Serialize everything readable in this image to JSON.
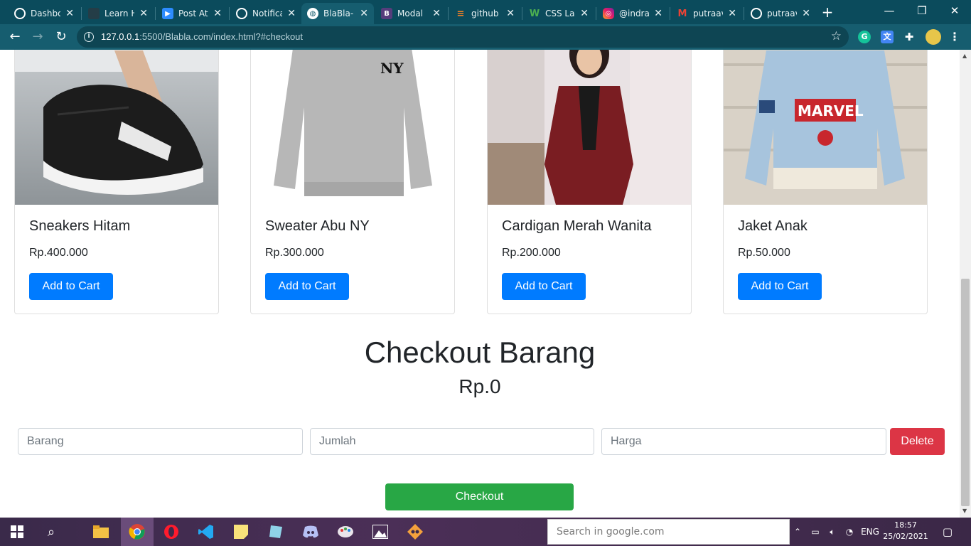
{
  "browser": {
    "tabs": [
      {
        "title": "Dashbo",
        "icon": "github-icon",
        "active": false
      },
      {
        "title": "Learn H",
        "icon": "learn-icon",
        "active": false
      },
      {
        "title": "Post At",
        "icon": "zoom-icon",
        "active": false
      },
      {
        "title": "Notifica",
        "icon": "github-icon",
        "active": false
      },
      {
        "title": "BlaBla-",
        "icon": "globe-icon",
        "active": true
      },
      {
        "title": "Modal",
        "icon": "bootstrap-icon",
        "active": false
      },
      {
        "title": "github",
        "icon": "stackoverflow-icon",
        "active": false
      },
      {
        "title": "CSS Lay",
        "icon": "w3schools-icon",
        "active": false
      },
      {
        "title": "@indra",
        "icon": "instagram-icon",
        "active": false
      },
      {
        "title": "putraav",
        "icon": "gmail-icon",
        "active": false
      },
      {
        "title": "putraav",
        "icon": "github-icon",
        "active": false
      }
    ],
    "url_host": "127.0.0.1",
    "url_rest": ":5500/Blabla.com/index.html?#checkout",
    "new_tab": "+",
    "win_minimize": "—",
    "win_restore": "❐",
    "win_close": "✕"
  },
  "products": [
    {
      "name": "Sneakers Hitam",
      "price": "Rp.400.000",
      "button": "Add to Cart",
      "image": "black-sneakers"
    },
    {
      "name": "Sweater Abu NY",
      "price": "Rp.300.000",
      "button": "Add to Cart",
      "image": "grey-sweater",
      "image_text": "NY"
    },
    {
      "name": "Cardigan Merah Wanita",
      "price": "Rp.200.000",
      "button": "Add to Cart",
      "image": "red-cardigan"
    },
    {
      "name": "Jaket Anak",
      "price": "Rp.50.000",
      "button": "Add to Cart",
      "image": "kids-jacket",
      "image_text": "MARVEL"
    }
  ],
  "checkout": {
    "title": "Checkout Barang",
    "total": "Rp.0",
    "fields": [
      {
        "placeholder": "Barang"
      },
      {
        "placeholder": "Jumlah"
      },
      {
        "placeholder": "Harga"
      }
    ],
    "delete_label": "Delete",
    "checkout_label": "Checkout"
  },
  "taskbar": {
    "search_placeholder": "Search in google.com",
    "language": "ENG",
    "time": "18:57",
    "date": "25/02/2021"
  },
  "colors": {
    "primary": "#007bff",
    "danger": "#dc3545",
    "success": "#28a745",
    "chrome_frame": "#0b4b5c",
    "chrome_toolbar": "#165d6f"
  }
}
